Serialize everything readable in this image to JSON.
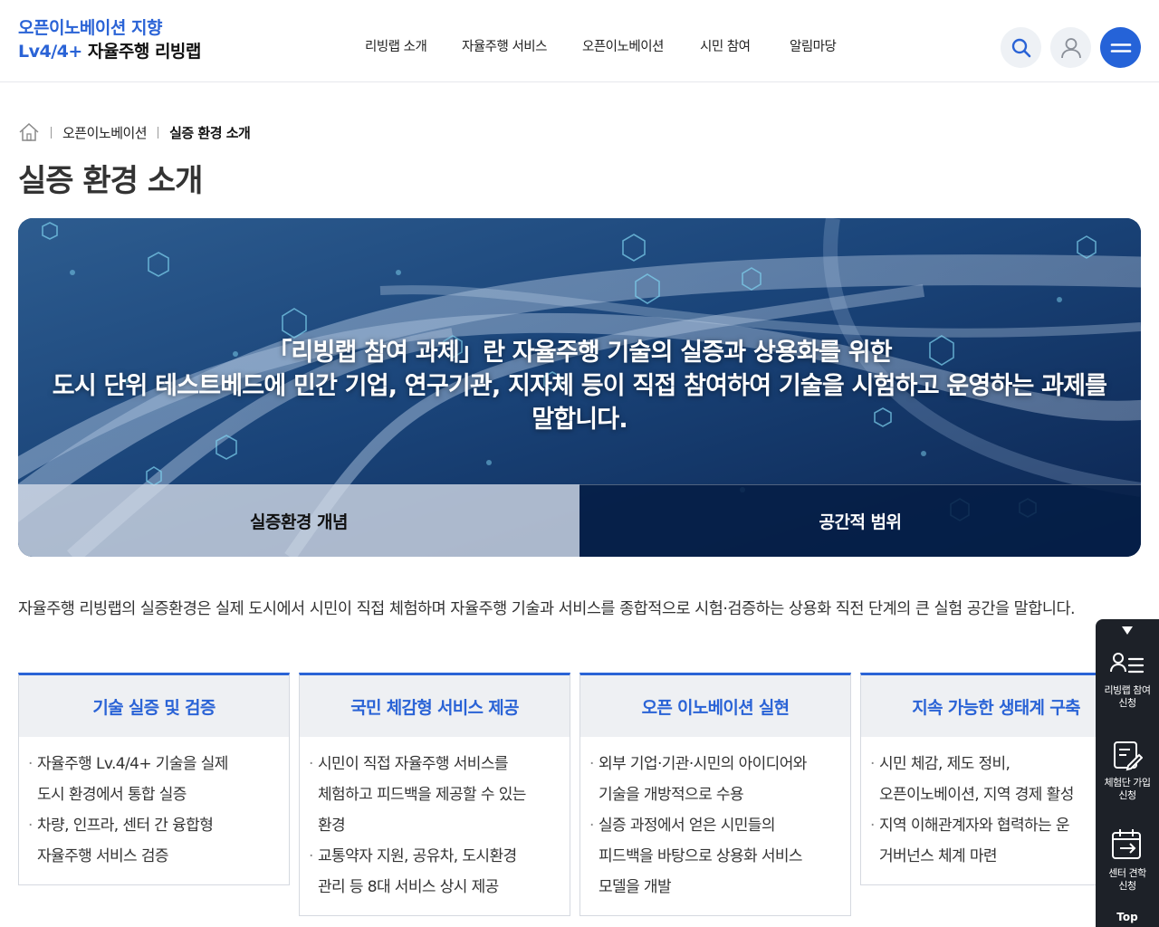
{
  "header": {
    "logo_line1": "오픈이노베이션 지향",
    "logo_line2_blue": "Lv4/4+",
    "logo_line2_rest": "자율주행 리빙랩",
    "nav": [
      "리빙랩 소개",
      "자율주행 서비스",
      "오픈이노베이션",
      "시민 참여",
      "알림마당"
    ],
    "colors": {
      "brand": "#2a63d6",
      "menu_button": "#2563d8"
    }
  },
  "breadcrumb": {
    "home_icon": "home-icon",
    "items": [
      "오픈이노베이션",
      "실증 환경 소개"
    ]
  },
  "page_title": "실증 환경 소개",
  "hero": {
    "lines": [
      "「리빙랩 참여 과제」란 자율주행 기술의 실증과 상용화를 위한",
      "도시 단위 테스트베드에 민간 기업, 연구기관, 지자체 등이 직접 참여하여 기술을 시험하고 운영하는 과제를",
      "말합니다."
    ],
    "tabs": [
      "실증환경 개념",
      "공간적 범위"
    ],
    "active_tab": 0
  },
  "intro": {
    "text": "자율주행 리빙랩의 실증환경은 실제 도시에서 시민이 직접 체험하며 자율주행 기술과 서비스를 종합적으로 시험·검증하는 상용화 직전 단계의 큰 실험 공간을 말합니다."
  },
  "cards": [
    {
      "title": "기술 실증 및 검증",
      "items": [
        [
          "자율주행 Lv.4/4+ 기술을 실제",
          "도시 환경에서 통합 실증"
        ],
        [
          "차량, 인프라, 센터 간 융합형",
          "자율주행 서비스 검증"
        ]
      ]
    },
    {
      "title": "국민 체감형 서비스 제공",
      "items": [
        [
          "시민이 직접 자율주행 서비스를",
          "체험하고 피드백을 제공할 수 있는",
          "환경"
        ],
        [
          "교통약자 지원, 공유차, 도시환경",
          "관리 등 8대 서비스 상시 제공"
        ]
      ]
    },
    {
      "title": "오픈 이노베이션 실현",
      "items": [
        [
          "외부 기업·기관·시민의 아이디어와",
          "기술을 개방적으로 수용"
        ],
        [
          "실증 과정에서 얻은 시민들의",
          "피드백을 바탕으로 상용화 서비스",
          "모델을 개발"
        ]
      ]
    },
    {
      "title": "지속 가능한 생태계 구축",
      "items": [
        [
          "시민 체감, 제도 정비,",
          "오픈이노베이션, 지역 경제 활성"
        ],
        [
          "지역 이해관계자와 협력하는 운",
          "거버넌스 체계 마련"
        ]
      ]
    }
  ],
  "quick_menu": {
    "items": [
      {
        "icon": "member-list-icon",
        "label": [
          "리빙랩 참여",
          "신청"
        ]
      },
      {
        "icon": "edit-document-icon",
        "label": [
          "체험단 가입",
          "신청"
        ]
      },
      {
        "icon": "calendar-arrow-icon",
        "label": [
          "센터 견학",
          "신청"
        ]
      }
    ],
    "top_label": "Top"
  }
}
